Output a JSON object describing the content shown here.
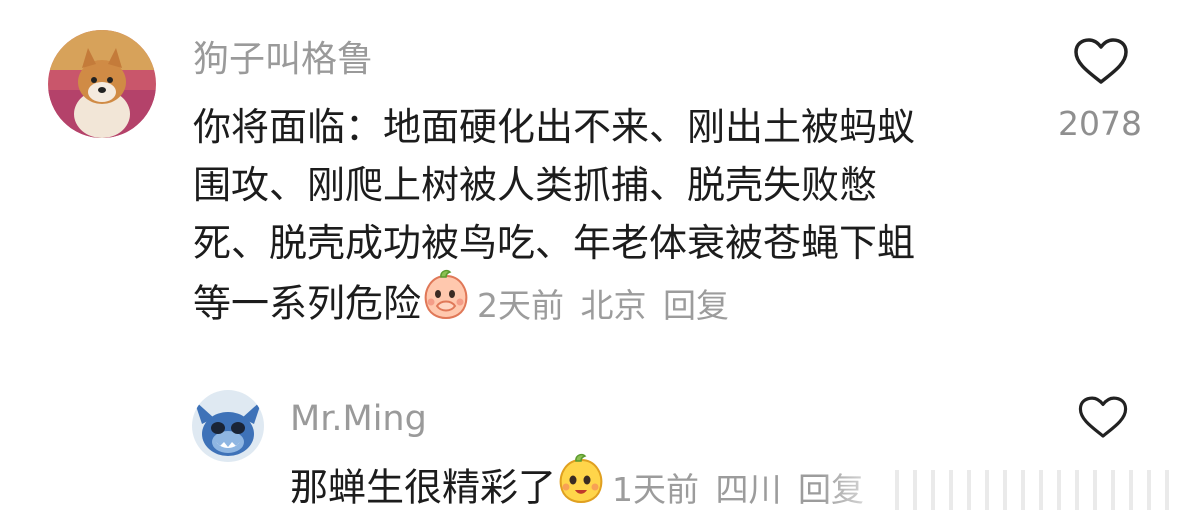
{
  "comment": {
    "username": "狗子叫格鲁",
    "lines": [
      "你将面临：地面硬化出不来、刚出土被蚂蚁",
      "围攻、刚爬上树被人类抓捕、脱壳失败憋",
      "死、脱壳成功被鸟吃、年老体衰被苍蝇下蛆",
      "等一系列危险"
    ],
    "emoji": "peach-hand-over-mouth-emoji",
    "time": "2天前",
    "location": "北京",
    "reply_label": "回复",
    "like_icon": "heart-outline-icon",
    "like_count": "2078"
  },
  "reply": {
    "username": "Mr.Ming",
    "text": "那蝉生很精彩了",
    "emoji": "yellow-peach-smile-emoji",
    "time": "1天前",
    "location": "四川",
    "reply_label": "回复",
    "like_icon": "heart-outline-icon"
  },
  "colors": {
    "username": "#9a9a9a",
    "body": "#1c1c1c",
    "meta": "#9c9c9c",
    "heart": "#222222"
  }
}
